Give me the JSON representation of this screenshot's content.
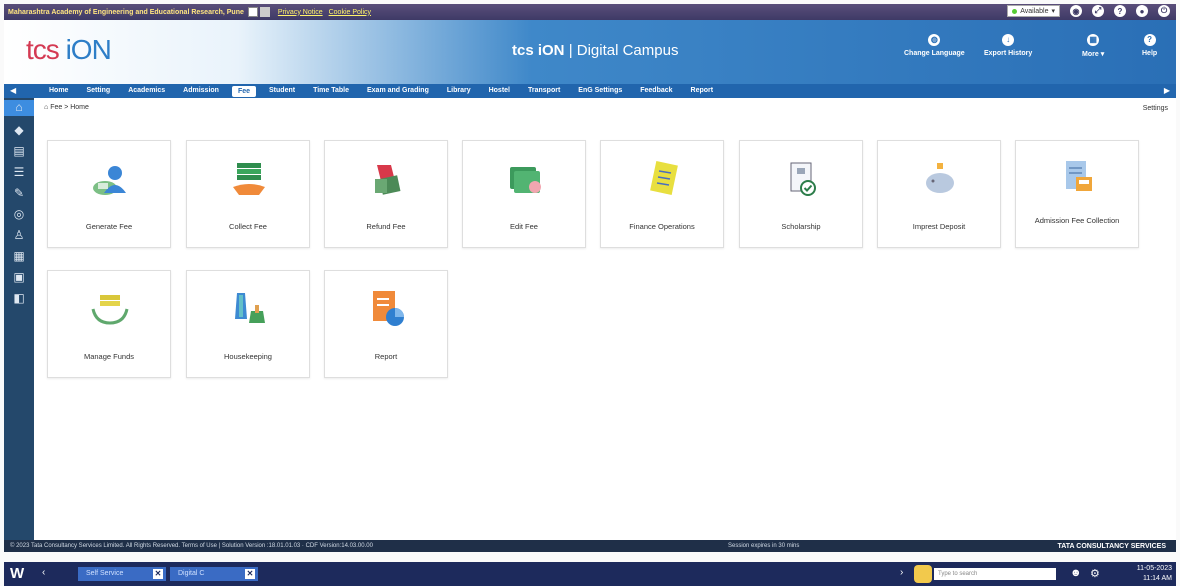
{
  "topbar": {
    "institute": "Maharashtra Academy of Engineering and Educational Research, Pune",
    "privacy": "Privacy Notice",
    "cookie": "Cookie Policy",
    "status": "Available"
  },
  "header": {
    "logo_tcs": "tcs",
    "logo_ion": "iON",
    "title_brand": "tcs iON",
    "title_sub": "| Digital Campus",
    "actions": [
      {
        "label": "Change Language",
        "icon": "globe-icon"
      },
      {
        "label": "Export History",
        "icon": "download-icon"
      },
      {
        "label": "More",
        "icon": "grid-icon"
      },
      {
        "label": "Help",
        "icon": "help-icon"
      }
    ]
  },
  "nav": {
    "items": [
      "Home",
      "Setting",
      "Academics",
      "Admission",
      "Fee",
      "Student",
      "Time Table",
      "Exam and Grading",
      "Library",
      "Hostel",
      "Transport",
      "EnG Settings",
      "Feedback",
      "Report"
    ],
    "active": "Fee"
  },
  "content": {
    "breadcrumb": "Fee > Home",
    "settings": "Settings",
    "tiles": [
      "Generate Fee",
      "Collect Fee",
      "Refund Fee",
      "Edit Fee",
      "Finance Operations",
      "Scholarship",
      "Imprest Deposit",
      "Admission Fee Collection",
      "Manage Funds",
      "Housekeeping",
      "Report"
    ]
  },
  "footer": {
    "copyright": "© 2023 Tata Consultancy Services Limited. All Rights Reserved.   Terms of Use | Solution Version :18.01.01.03 · CDF Version:14.03.00.00",
    "session": "Session expires in 30 mins",
    "brand": "TATA CONSULTANCY SERVICES"
  },
  "taskbar": {
    "tab1": "Self Service",
    "tab2": "Digital C",
    "search_placeholder": "Type to search",
    "date": "11-05-2023",
    "time": "11:14 AM"
  },
  "colors": {
    "nav_blue": "#2165ad",
    "sidebar": "#24486b",
    "logo_red": "#d43a53",
    "logo_blue": "#2e7ec7"
  }
}
